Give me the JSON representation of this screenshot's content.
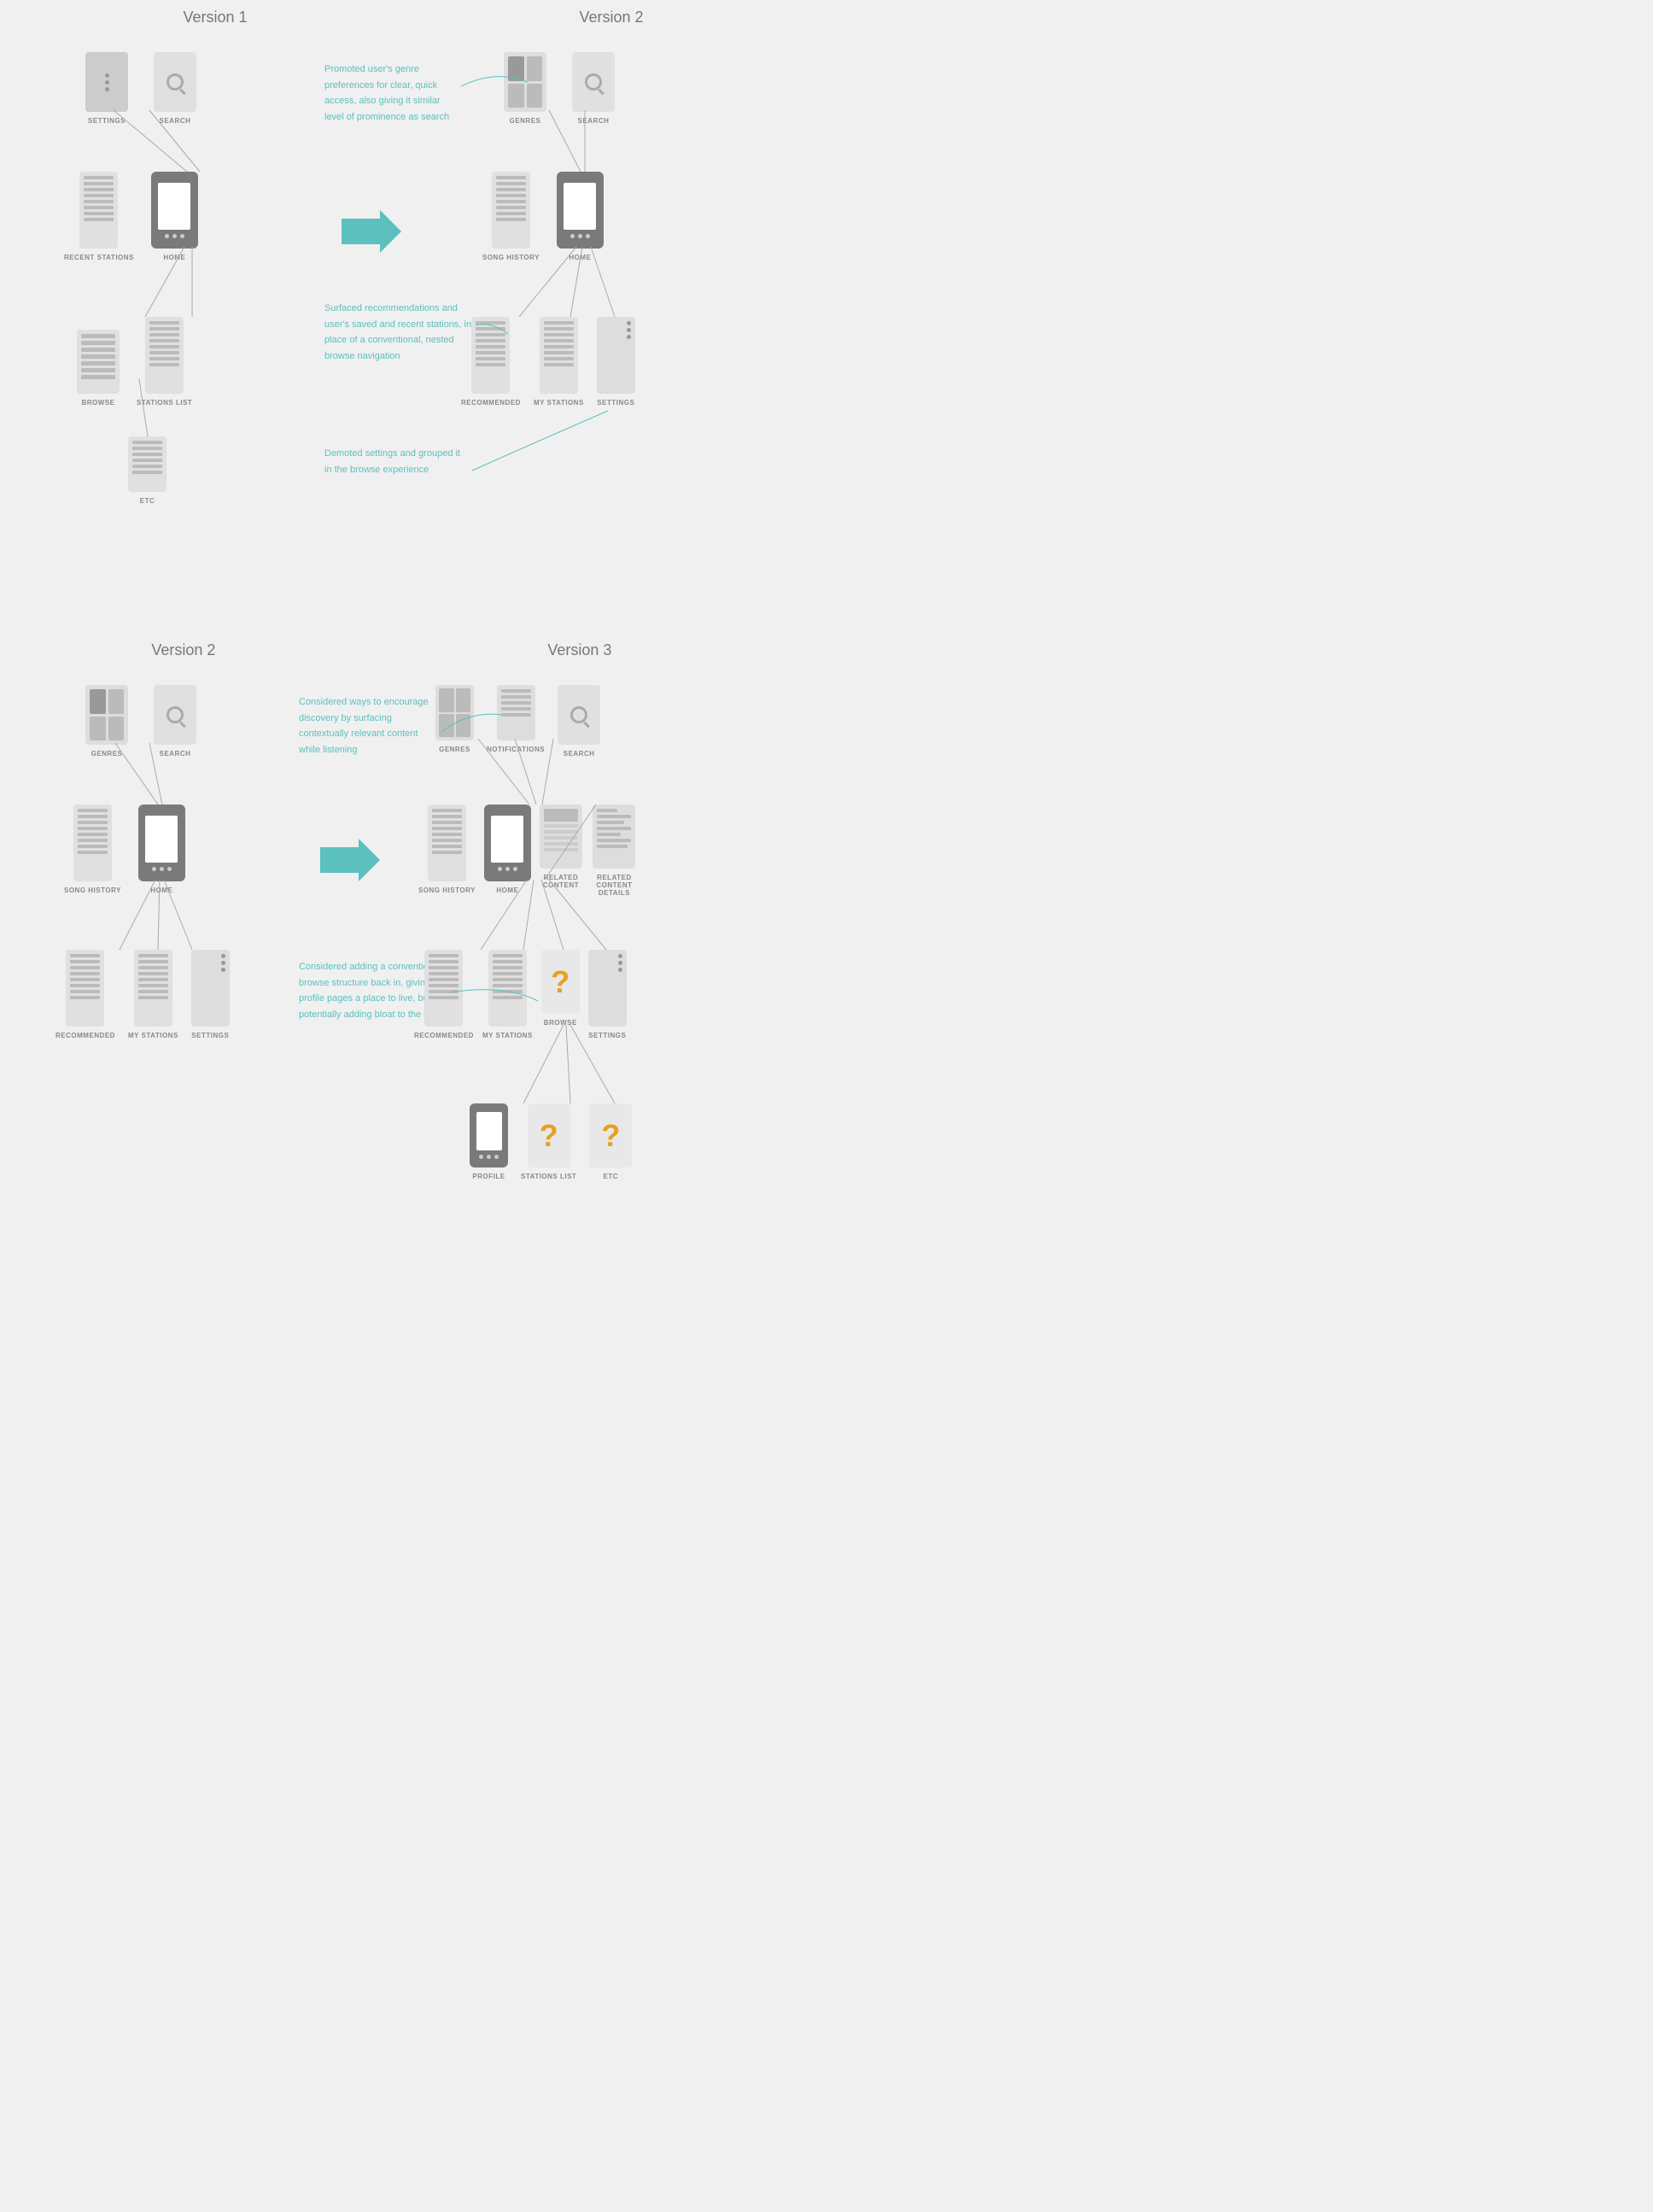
{
  "sections": [
    {
      "id": "v1v2",
      "title_left": "Version 1",
      "title_right": "Version 2",
      "annotations": [
        {
          "id": "ann1",
          "text": "Promoted user's genre preferences for clear, quick access, also giving it similar level of prominence as search"
        },
        {
          "id": "ann2",
          "text": "Surfaced recommendations and user's saved and recent stations, in place of a conventional, nested browse navigation"
        },
        {
          "id": "ann3",
          "text": "Demoted settings and grouped it in the browse experience"
        }
      ],
      "v1_nodes": {
        "top": [
          {
            "id": "v1-settings",
            "type": "settings",
            "label": "SETTINGS"
          },
          {
            "id": "v1-search",
            "type": "search",
            "label": "SEARCH"
          }
        ],
        "middle": [
          {
            "id": "v1-recent",
            "type": "list",
            "label": "RECENT STATIONS"
          },
          {
            "id": "v1-home",
            "type": "phone",
            "label": "HOME"
          }
        ],
        "bottom": [
          {
            "id": "v1-browse",
            "type": "browse",
            "label": "BROWSE"
          },
          {
            "id": "v1-stations",
            "type": "list",
            "label": "STATIONS LIST"
          }
        ],
        "extra": [
          {
            "id": "v1-etc",
            "type": "etc",
            "label": "ETC"
          }
        ]
      },
      "v2_nodes": {
        "top": [
          {
            "id": "v2-genres",
            "type": "genres",
            "label": "GENRES"
          },
          {
            "id": "v2-search",
            "type": "search",
            "label": "SEARCH"
          }
        ],
        "middle": [
          {
            "id": "v2-song",
            "type": "list",
            "label": "SONG HISTORY"
          },
          {
            "id": "v2-home",
            "type": "phone",
            "label": "HOME"
          }
        ],
        "bottom": [
          {
            "id": "v2-recommended",
            "type": "list",
            "label": "RECOMMENDED"
          },
          {
            "id": "v2-stations",
            "type": "list",
            "label": "MY STATIONS"
          },
          {
            "id": "v2-settings",
            "type": "settings-tall",
            "label": "SETTINGS"
          }
        ]
      }
    },
    {
      "id": "v2v3",
      "title_left": "Version 2",
      "title_right": "Version 3",
      "annotations": [
        {
          "id": "ann4",
          "text": "Considered ways to encourage discovery by surfacing contextually relevant content while listening"
        },
        {
          "id": "ann5",
          "text": "Considered adding a conventional browse structure back in, giving profile pages a place to live, but potentially adding bloat to the app"
        }
      ],
      "v2_nodes": {
        "top": [
          {
            "id": "v2b-genres",
            "type": "genres",
            "label": "GENRES"
          },
          {
            "id": "v2b-search",
            "type": "search",
            "label": "SEARCH"
          }
        ],
        "middle": [
          {
            "id": "v2b-song",
            "type": "list",
            "label": "SONG HISTORY"
          },
          {
            "id": "v2b-home",
            "type": "phone",
            "label": "HOME"
          }
        ],
        "bottom": [
          {
            "id": "v2b-recommended",
            "type": "list",
            "label": "RECOMMENDED"
          },
          {
            "id": "v2b-stations",
            "type": "list",
            "label": "MY STATIONS"
          },
          {
            "id": "v2b-settings",
            "type": "settings-tall",
            "label": "SETTINGS"
          }
        ]
      },
      "v3_nodes": {
        "top": [
          {
            "id": "v3-genres",
            "type": "genres-small",
            "label": "GENRES"
          },
          {
            "id": "v3-notifications",
            "type": "notification",
            "label": "NOTIFICATIONS"
          },
          {
            "id": "v3-search",
            "type": "search",
            "label": "SEARCH"
          }
        ],
        "middle": [
          {
            "id": "v3-song",
            "type": "list",
            "label": "SONG HISTORY"
          },
          {
            "id": "v3-home",
            "type": "phone",
            "label": "HOME"
          },
          {
            "id": "v3-related",
            "type": "related",
            "label": "RELATED CONTENT"
          },
          {
            "id": "v3-related-details",
            "type": "related-details",
            "label": "RELATED CONTENT DETAILS"
          }
        ],
        "bottom": [
          {
            "id": "v3-recommended",
            "type": "list",
            "label": "RECOMMENDED"
          },
          {
            "id": "v3-stations",
            "type": "list",
            "label": "MY STATIONS"
          },
          {
            "id": "v3-browse",
            "type": "question",
            "label": "BROWSE"
          },
          {
            "id": "v3-settings",
            "type": "settings-tall",
            "label": "SETTINGS"
          }
        ],
        "extra": [
          {
            "id": "v3-profile",
            "type": "phone-small",
            "label": "PROFILE"
          },
          {
            "id": "v3-stations-list",
            "type": "question",
            "label": "STATIONS LIST"
          },
          {
            "id": "v3-etc",
            "type": "question",
            "label": "ETC"
          }
        ]
      }
    }
  ],
  "colors": {
    "teal": "#5bc0be",
    "orange": "#e8a020",
    "arrow_color": "#5bc0be",
    "node_bg_dark": "#7a7a7a",
    "node_bg_light": "#e0e0e0",
    "node_bg_mid": "#d0d0d0",
    "line_color": "#999",
    "text_annotation": "#5bc0be",
    "label_color": "#888"
  }
}
